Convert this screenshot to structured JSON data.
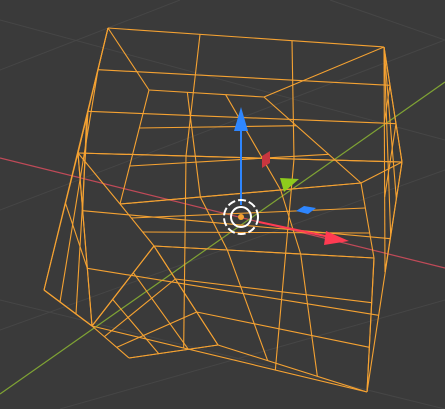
{
  "viewport": {
    "background": "#3a3a3a",
    "grid_color": "#464646"
  },
  "axes": {
    "x_axis": {
      "color": "#c04a58"
    },
    "y_axis": {
      "color": "#7fa334"
    }
  },
  "mesh": {
    "icon": "wireframe-cube-subdivided-icon",
    "wire_color": "#f5a232",
    "subdivisions": 3
  },
  "gizmo": {
    "z_arrow_color": "#2e86ff",
    "x_arrow_color": "#ff3b52",
    "y_arrow_color": "#8ecb1c",
    "xz_plane_color": "#c8363f",
    "xy_plane_color": "#2e86ff",
    "center_ring_color": "#ffffff"
  }
}
